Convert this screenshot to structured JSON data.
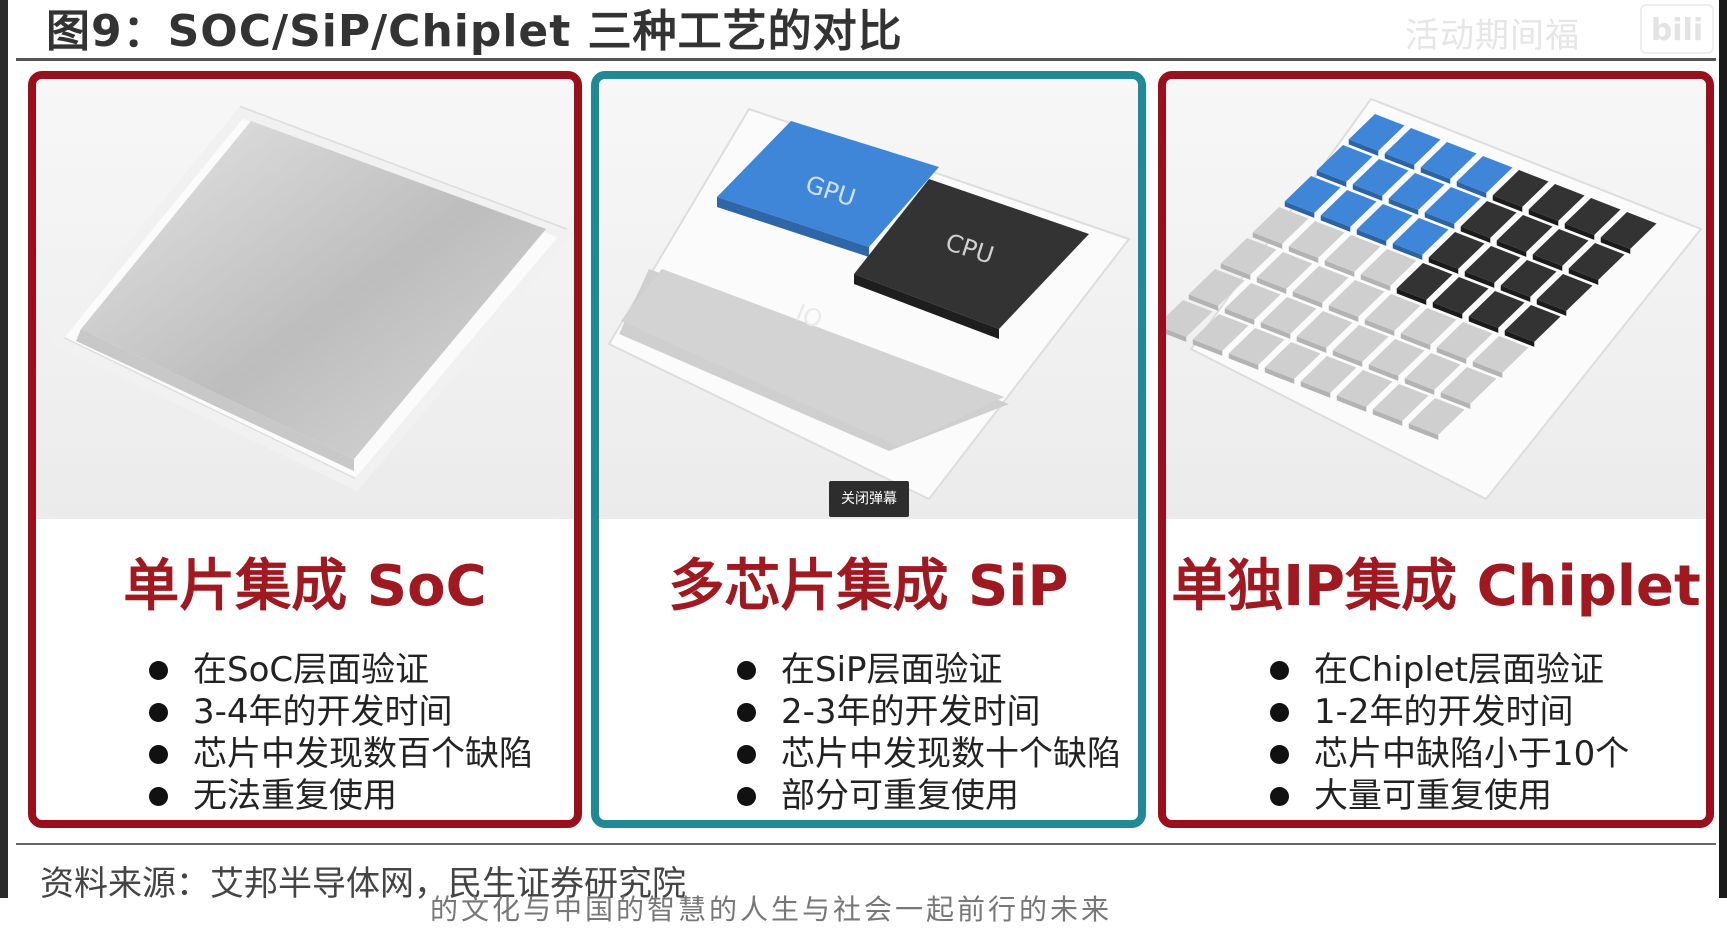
{
  "title": "图9：SOC/SiP/Chiplet 三种工艺的对比",
  "watermark": {
    "text": "活动期间福",
    "logo": "bili"
  },
  "panels": [
    {
      "title": "单片集成 SoC",
      "border_color": "#9a0f1c",
      "bullets": [
        "在SoC层面验证",
        "3-4年的开发时间",
        "芯片中发现数百个缺陷",
        "无法重复使用"
      ]
    },
    {
      "title": "多芯片集成 SiP",
      "border_color": "#1f8a96",
      "chip_labels": [
        "GPU",
        "CPU",
        "IO"
      ],
      "bullets": [
        "在SiP层面验证",
        "2-3年的开发时间",
        "芯片中发现数十个缺陷",
        "部分可重复使用"
      ]
    },
    {
      "title": "单独IP集成 Chiplet",
      "border_color": "#9a0f1c",
      "bullets": [
        "在Chiplet层面验证",
        "1-2年的开发时间",
        "芯片中缺陷小于10个",
        "大量可重复使用"
      ]
    }
  ],
  "colors": {
    "title_red": "#a01820",
    "gpu_blue": "#3f86d8",
    "cpu_dark": "#333333"
  },
  "popup": {
    "close_danmaku_label": "关闭弹幕"
  },
  "source": "资料来源：艾邦半导体网，民生证券研究院",
  "cut_off_text": "的文化与中国的智慧的人生与社会一起前行的未来"
}
